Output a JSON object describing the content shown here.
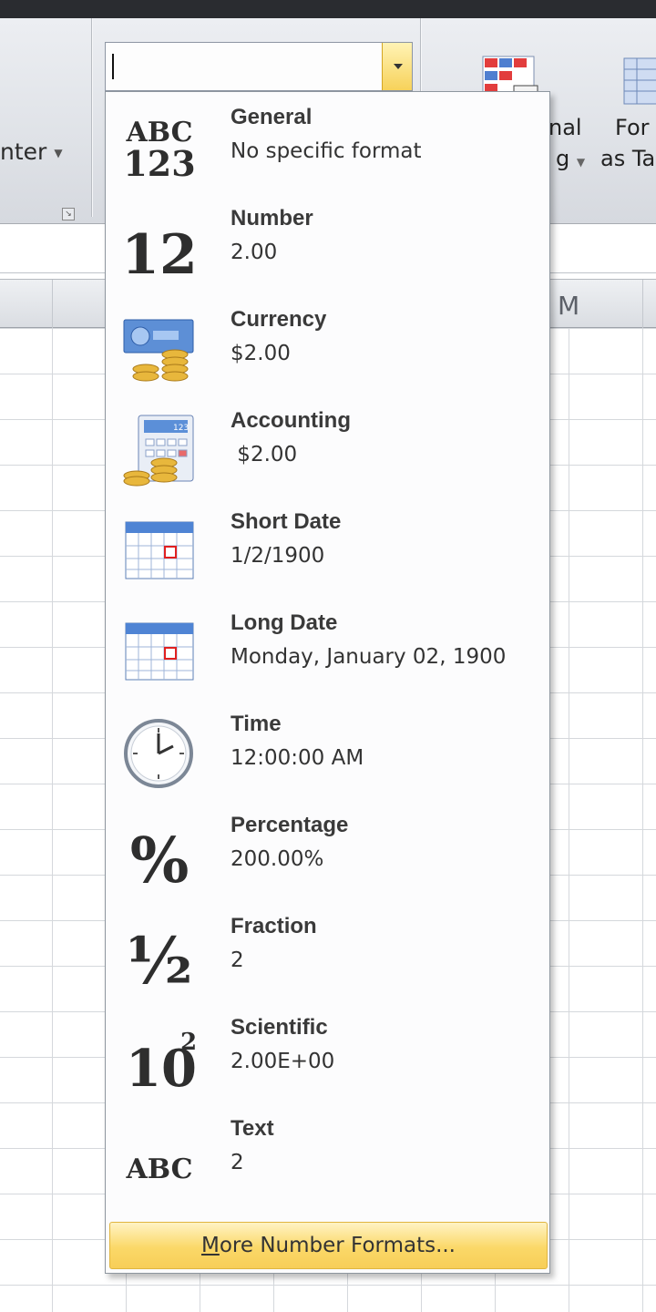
{
  "ribbon": {
    "merge_center_label": "nter",
    "conditional_label_line1": "nal",
    "conditional_label_line2": "g",
    "format_table_line1": "For",
    "format_table_line2": "as Ta"
  },
  "grid": {
    "visible_column": "M"
  },
  "number_format_menu": {
    "items": [
      {
        "name": "General",
        "sample": "No specific format",
        "icon": "abc-123-icon"
      },
      {
        "name": "Number",
        "sample": "2.00",
        "icon": "number-12-icon"
      },
      {
        "name": "Currency",
        "sample": "$2.00",
        "icon": "currency-coins-icon"
      },
      {
        "name": "Accounting",
        "sample": " $2.00",
        "icon": "accounting-calculator-icon"
      },
      {
        "name": "Short Date",
        "sample": "1/2/1900",
        "icon": "calendar-icon"
      },
      {
        "name": "Long Date",
        "sample": "Monday, January 02, 1900",
        "icon": "calendar-icon"
      },
      {
        "name": "Time",
        "sample": "12:00:00 AM",
        "icon": "clock-icon"
      },
      {
        "name": "Percentage",
        "sample": "200.00%",
        "icon": "percent-icon"
      },
      {
        "name": "Fraction",
        "sample": "2",
        "icon": "fraction-half-icon"
      },
      {
        "name": "Scientific",
        "sample": "2.00E+00",
        "icon": "exponent-icon"
      },
      {
        "name": "Text",
        "sample": "2",
        "icon": "abc-text-icon"
      }
    ],
    "more_formats_accel": "M",
    "more_formats_rest": "ore Number Formats..."
  },
  "colors": {
    "menu_highlight": "#fbd868",
    "menu_border": "#8e969f",
    "ribbon_bg": "#dfe2e7"
  }
}
